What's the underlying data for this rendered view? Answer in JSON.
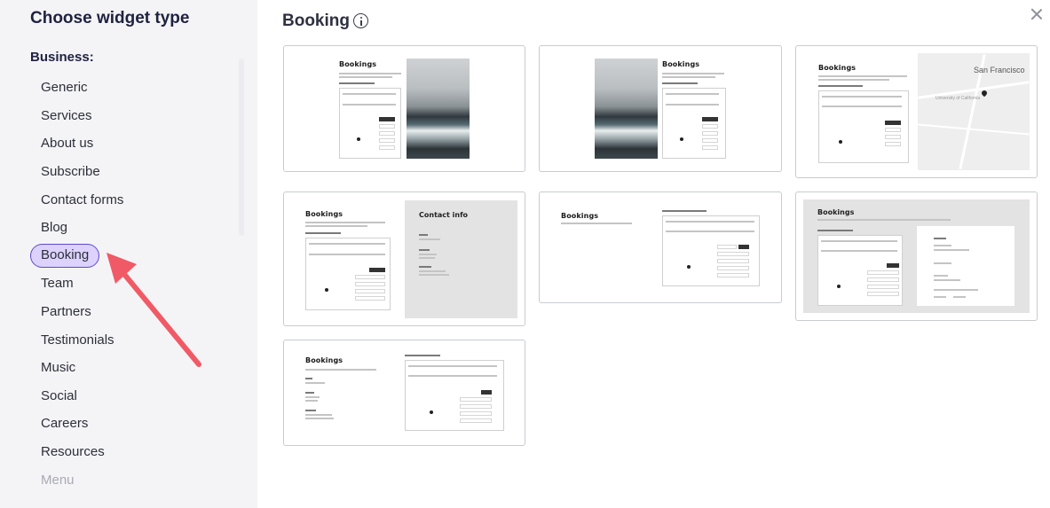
{
  "sidebar": {
    "title": "Choose widget type",
    "section": "Business:",
    "items": [
      {
        "label": "Generic"
      },
      {
        "label": "Services"
      },
      {
        "label": "About us"
      },
      {
        "label": "Subscribe"
      },
      {
        "label": "Contact forms"
      },
      {
        "label": "Blog"
      },
      {
        "label": "Booking"
      },
      {
        "label": "Team"
      },
      {
        "label": "Partners"
      },
      {
        "label": "Testimonials"
      },
      {
        "label": "Music"
      },
      {
        "label": "Social"
      },
      {
        "label": "Careers"
      },
      {
        "label": "Resources"
      },
      {
        "label": "Menu"
      }
    ],
    "active": "Booking"
  },
  "main": {
    "title": "Booking",
    "info_icon": "info-icon",
    "close_icon": "close-icon"
  },
  "templates": {
    "heading": "Bookings",
    "contact_heading": "Contact info",
    "map_city": "San Francisco",
    "map_label": "University of California"
  },
  "colors": {
    "active_bg": "#dcd2fb",
    "active_border": "#5e4ad0",
    "arrow": "#f05a66"
  }
}
